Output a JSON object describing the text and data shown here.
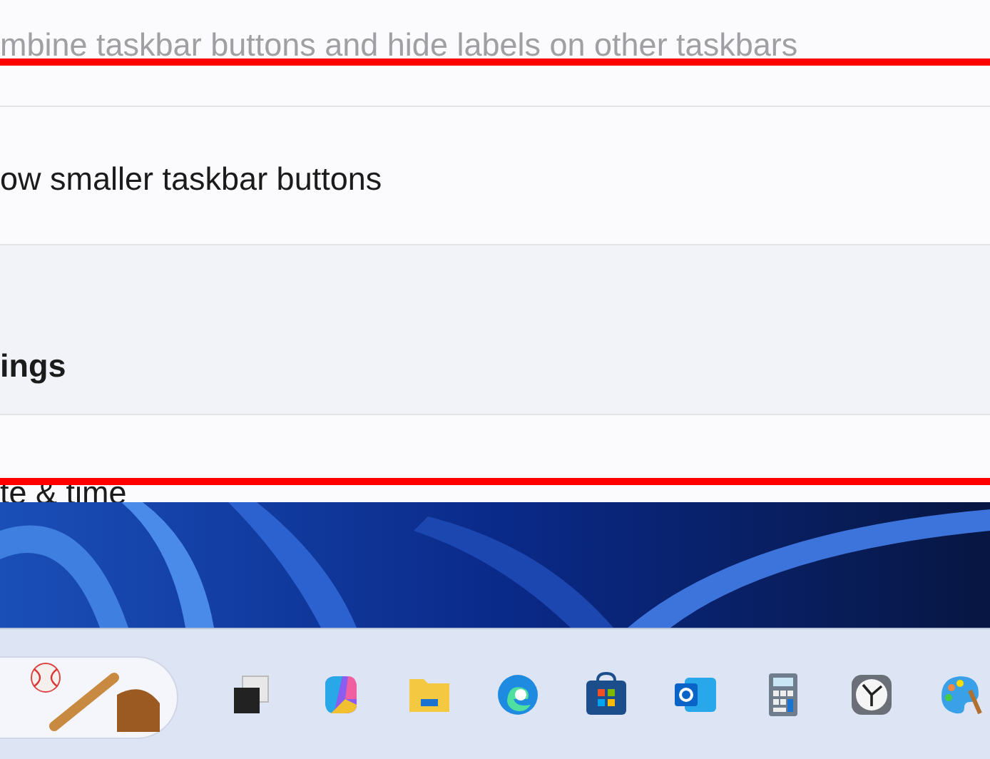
{
  "settings": {
    "rows": [
      {
        "label": "mbine taskbar buttons and hide labels on other taskbars",
        "disabled": true
      },
      {
        "label": "ow smaller taskbar buttons",
        "disabled": false
      }
    ],
    "section_heading": "ings",
    "next_row": {
      "label": "te & time"
    }
  }
}
